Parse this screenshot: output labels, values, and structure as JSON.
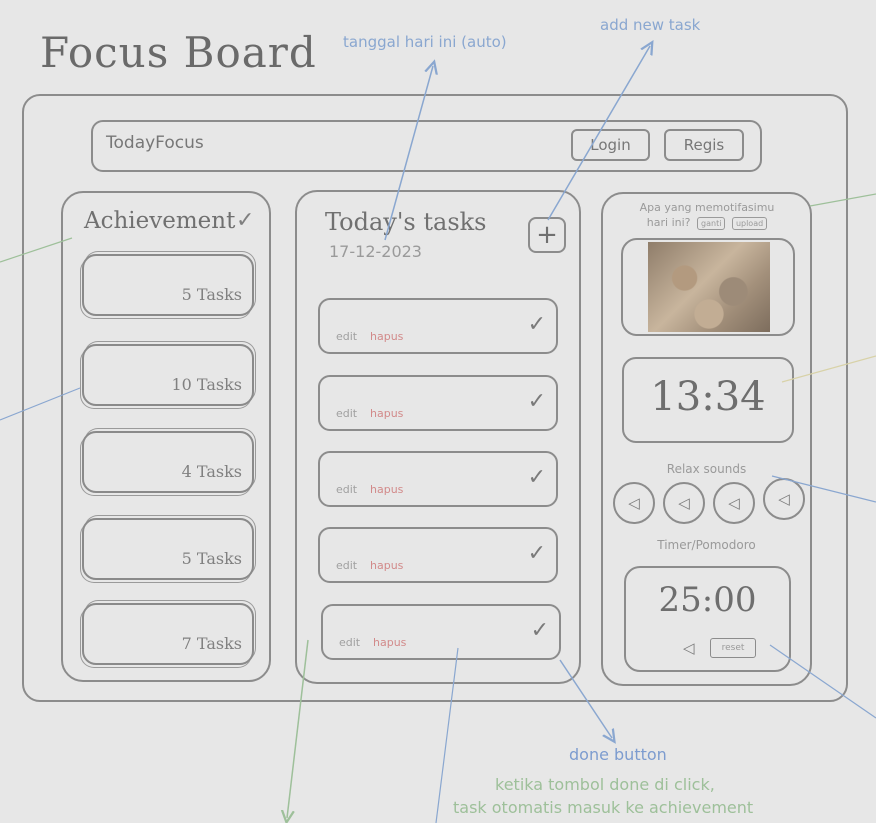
{
  "page": {
    "title": "Focus Board"
  },
  "annotations": {
    "date_note": "tanggal hari ini (auto)",
    "add_task_note": "add new task",
    "done_button_note": "done button",
    "done_explain_1": "ketika tombol done di click,",
    "done_explain_2": "task otomatis masuk ke achievement"
  },
  "navbar": {
    "brand": "TodayFocus",
    "login_label": "Login",
    "register_label": "Regis"
  },
  "achievement": {
    "title": "Achievement",
    "check_symbol": "✓",
    "cards": [
      {
        "label": "5 Tasks"
      },
      {
        "label": "10 Tasks"
      },
      {
        "label": "4 Tasks"
      },
      {
        "label": "5 Tasks"
      },
      {
        "label": "7 Tasks"
      }
    ]
  },
  "tasks": {
    "title": "Today's tasks",
    "date": "17-12-2023",
    "add_symbol": "+",
    "edit_label": "edit",
    "delete_label": "hapus",
    "done_symbol": "✓",
    "row_count": 5
  },
  "motivation": {
    "question_line1": "Apa yang memotifasimu",
    "question_line2": "hari ini?",
    "button_1": "ganti",
    "button_2": "upload"
  },
  "clock": {
    "time": "13:34"
  },
  "relax": {
    "label": "Relax sounds",
    "button_symbol": "◁",
    "count": 4
  },
  "timer": {
    "label": "Timer/Pomodoro",
    "time": "25:00",
    "play_symbol": "◁",
    "reset_label": "reset"
  },
  "colors": {
    "stroke": "#8c8c8c",
    "note_blue": "#8aa7d0",
    "note_green": "#9ec09a",
    "delete_red": "#d28a8a"
  }
}
